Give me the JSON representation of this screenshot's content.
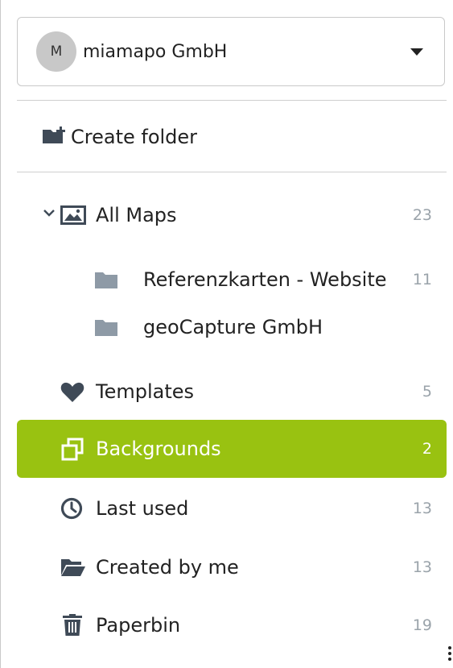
{
  "account": {
    "avatar_initial": "M",
    "name": "miamapo GmbH"
  },
  "actions": {
    "create_folder": "Create folder"
  },
  "nav": {
    "all_maps": {
      "label": "All Maps",
      "count": "23"
    },
    "folders": [
      {
        "label": "Referenzkarten - Website",
        "count": "11"
      },
      {
        "label": "geoCapture GmbH",
        "count": ""
      }
    ],
    "templates": {
      "label": "Templates",
      "count": "5"
    },
    "backgrounds": {
      "label": "Backgrounds",
      "count": "2"
    },
    "last_used": {
      "label": "Last used",
      "count": "13"
    },
    "created_by_me": {
      "label": "Created by me",
      "count": "13"
    },
    "paperbin": {
      "label": "Paperbin",
      "count": "19"
    }
  },
  "colors": {
    "active": "#99c211",
    "icon": "#3f4a57",
    "folder": "#8e9aa6",
    "count": "#9aa3aa"
  }
}
